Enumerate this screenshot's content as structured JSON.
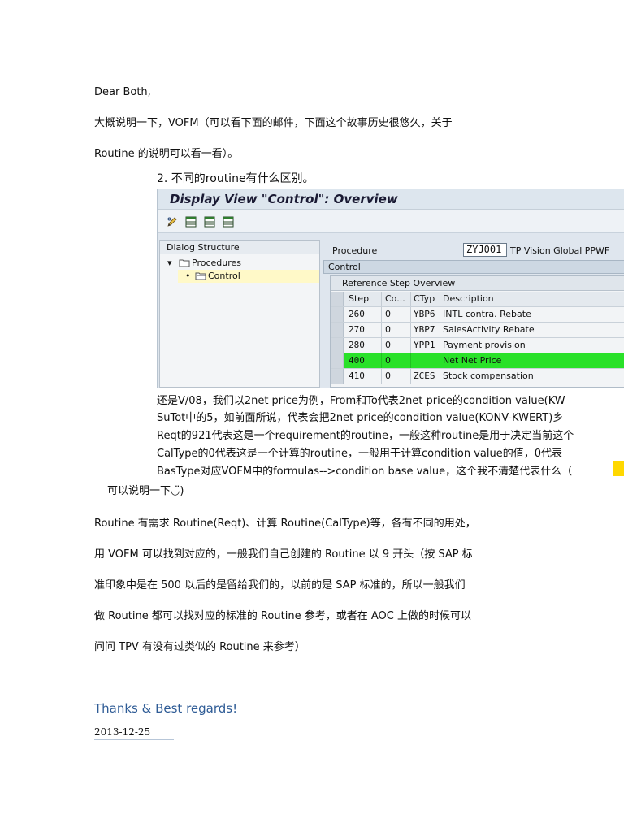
{
  "letter": {
    "greeting": "Dear Both,",
    "intro_line1": "大概说明一下，VOFM（可以看下面的邮件，下面这个故事历史很悠久，关于",
    "intro_line2": "Routine 的说明可以看一看）。",
    "quote_heading": "2. 不同的routine有什么区别。"
  },
  "sap_screen": {
    "title": "Display View \"Control\": Overview",
    "toolbar_icons": [
      "pencil-icon",
      "table-icon",
      "table-icon",
      "table-icon"
    ],
    "dialog_structure": {
      "header": "Dialog Structure",
      "items": [
        {
          "label": "Procedures",
          "level": 1,
          "expanded": true
        },
        {
          "label": "Control",
          "level": 2,
          "selected": true
        }
      ]
    },
    "procedure_label": "Procedure",
    "procedure_value": "ZYJ001",
    "procedure_desc": "TP Vision Global PPWF",
    "control_tab": "Control",
    "ref_overview": "Reference Step Overview",
    "columns": [
      "Step",
      "Co...",
      "CTyp",
      "Description"
    ],
    "rows": [
      {
        "step": "260",
        "co": "0",
        "ctyp": "YBP6",
        "desc": "INTL contra. Rebate",
        "highlight": false
      },
      {
        "step": "270",
        "co": "0",
        "ctyp": "YBP7",
        "desc": "SalesActivity Rebate",
        "highlight": false
      },
      {
        "step": "280",
        "co": "0",
        "ctyp": "YPP1",
        "desc": "Payment provision",
        "highlight": false
      },
      {
        "step": "400",
        "co": "0",
        "ctyp": "",
        "desc": "Net Net Price",
        "highlight": true
      },
      {
        "step": "410",
        "co": "0",
        "ctyp": "ZCES",
        "desc": "Stock compensation",
        "highlight": false
      }
    ],
    "highlight_color": "#29e129"
  },
  "quote_text": {
    "line1": "还是V/08，我们以2net price为例，From和To代表2net price的condition value(KW",
    "line2": "SuTot中的5，如前面所说，代表会把2net price的condition value(KONV-KWERT)乡",
    "line3": "Reqt的921代表这是一个requirement的routine，一般这种routine是用于决定当前这个",
    "line4": "CalType的0代表这是一个计算的routine，一般用于计算condition value的值，0代表",
    "line5": "BasType对应VOFM中的formulas-->condition base value，这个我不清楚代表什么（",
    "line6": "可以说明一下",
    "smiley": "◡̈"
  },
  "body": {
    "p1": "Routine 有需求 Routine(Reqt)、计算 Routine(CalType)等，各有不同的用处，",
    "p2": "用 VOFM 可以找到对应的，一般我们自己创建的 Routine 以 9 开头（按 SAP 标",
    "p3": "准印象中是在 500 以后的是留给我们的，以前的是 SAP 标准的，所以一般我们",
    "p4": "做 Routine 都可以找对应的标准的 Routine 参考，或者在 AOC 上做的时候可以",
    "p5": "问问 TPV 有没有过类似的 Routine 来参考）"
  },
  "signature": {
    "closing": "Thanks & Best regards!",
    "date": "2013-12-25"
  }
}
